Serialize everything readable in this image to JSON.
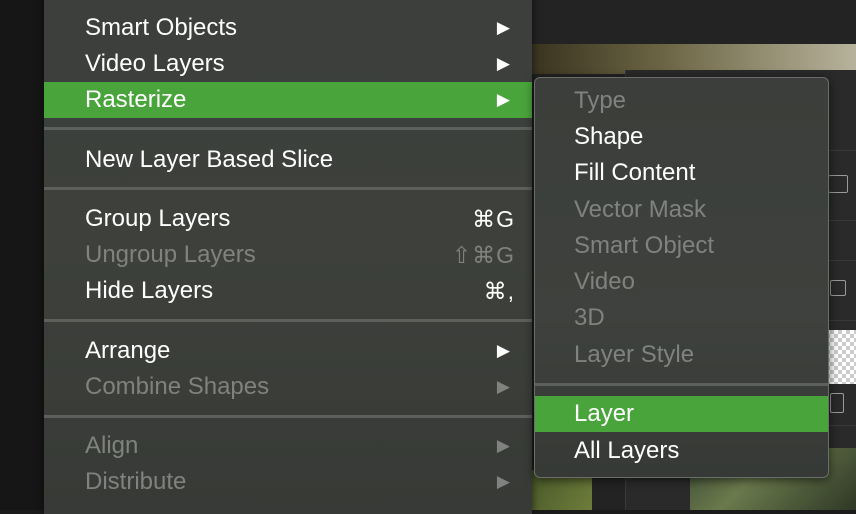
{
  "layer_menu": {
    "items": [
      {
        "label": "Smart Objects",
        "submenu": true,
        "disabled": false
      },
      {
        "label": "Video Layers",
        "submenu": true,
        "disabled": false
      },
      {
        "label": "Rasterize",
        "submenu": true,
        "disabled": false,
        "highlighted": true
      },
      {
        "label": "New Layer Based Slice",
        "disabled": false
      },
      {
        "label": "Group Layers",
        "shortcut": "⌘G",
        "disabled": false
      },
      {
        "label": "Ungroup Layers",
        "shortcut": "⇧⌘G",
        "disabled": true
      },
      {
        "label": "Hide Layers",
        "shortcut": "⌘,",
        "disabled": false
      },
      {
        "label": "Arrange",
        "submenu": true,
        "disabled": false
      },
      {
        "label": "Combine Shapes",
        "submenu": true,
        "disabled": true
      },
      {
        "label": "Align",
        "submenu": true,
        "disabled": true
      },
      {
        "label": "Distribute",
        "submenu": true,
        "disabled": true
      }
    ],
    "submenu_arrow": "▶"
  },
  "rasterize_submenu": {
    "items": [
      {
        "label": "Type",
        "disabled": true
      },
      {
        "label": "Shape",
        "disabled": false
      },
      {
        "label": "Fill Content",
        "disabled": false
      },
      {
        "label": "Vector Mask",
        "disabled": true
      },
      {
        "label": "Smart Object",
        "disabled": true
      },
      {
        "label": "Video",
        "disabled": true
      },
      {
        "label": "3D",
        "disabled": true
      },
      {
        "label": "Layer Style",
        "disabled": true
      },
      {
        "label": "Layer",
        "disabled": false,
        "highlighted": true
      },
      {
        "label": "All Layers",
        "disabled": false
      }
    ]
  },
  "colors": {
    "highlight": "#4aa43c",
    "menu_bg": "#3c3f3c",
    "disabled_text": "#7f827f"
  }
}
